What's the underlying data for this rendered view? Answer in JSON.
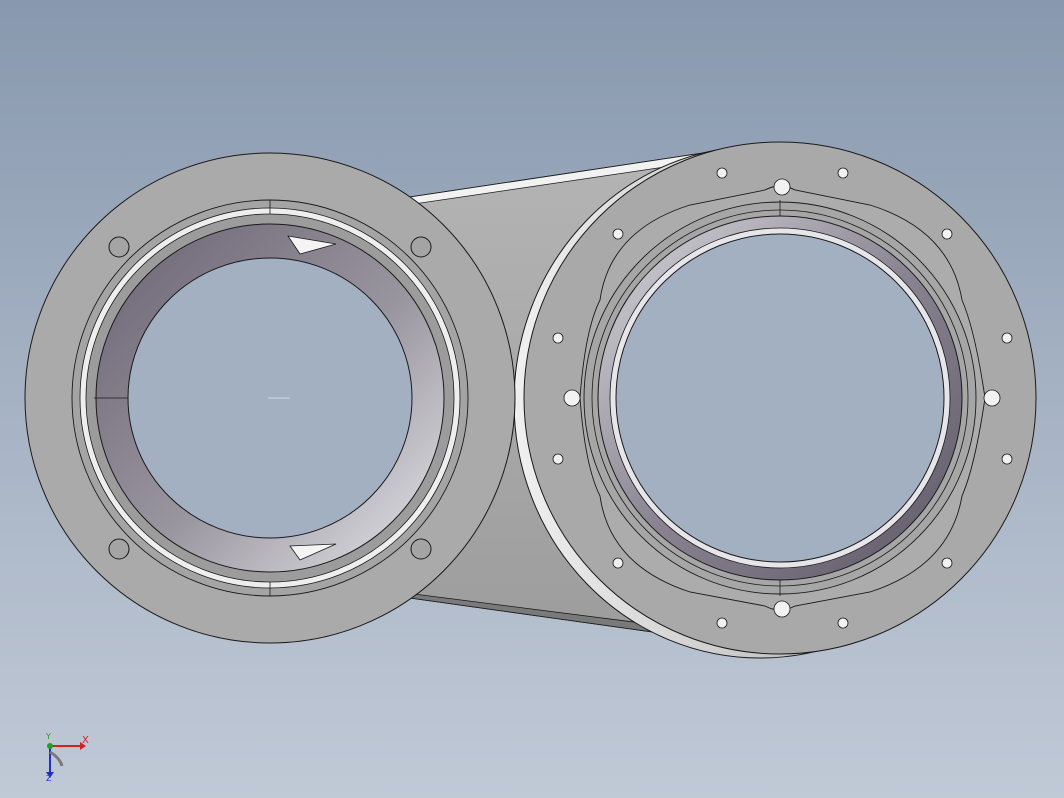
{
  "viewport": {
    "background_top": "#8898ae",
    "background_bottom": "#c0c9d6"
  },
  "model": {
    "description_icon": "cad-part-dual-flange-housing",
    "face_color": "#a8a8a8",
    "edge_color": "#1a1a1a",
    "bore_shadow_color": "#6e6876"
  },
  "triad": {
    "x_label": "X",
    "y_label": "Y",
    "z_label": "Z",
    "x_color": "#d42020",
    "y_color": "#20a020",
    "z_color": "#2030c8"
  }
}
